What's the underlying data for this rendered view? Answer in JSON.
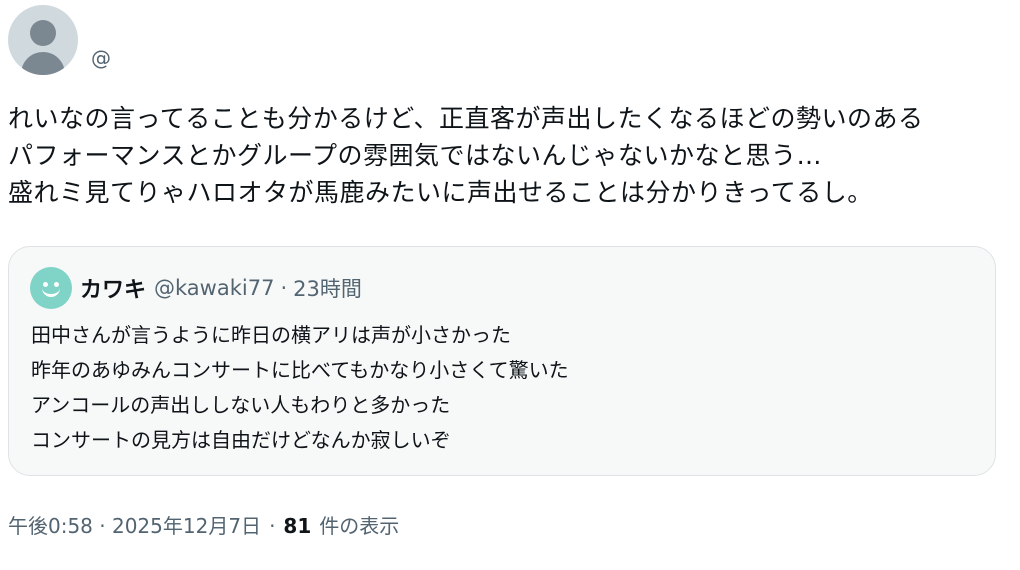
{
  "post": {
    "author_handle": "@",
    "text_lines": [
      "れいなの言ってることも分かるけど、正直客が声出したくなるほどの勢いのある",
      "パフォーマンスとかグループの雰囲気ではないんじゃないかなと思う…",
      "盛れミ見てりゃハロオタが馬鹿みたいに声出せることは分かりきってるし。"
    ],
    "timestamp": "午後0:58 · 2025年12月7日",
    "separator": "·",
    "view_count": "81",
    "view_label": "件の表示"
  },
  "quote": {
    "author_name": "カワキ",
    "author_handle": "@kawaki77",
    "separator": "·",
    "time": "23時間",
    "text_lines": [
      "田中さんが言うように昨日の横アリは声が小さかった",
      "昨年のあゆみんコンサートに比べてもかなり小さくて驚いた",
      "アンコールの声出ししない人もわりと多かった",
      "コンサートの見方は自由だけどなんか寂しいぞ"
    ]
  },
  "colors": {
    "text_primary": "#0f1419",
    "text_secondary": "#536471",
    "quote_background": "#f7f9f9",
    "quote_avatar": "#7fd3c7",
    "default_avatar": "#cfd9de"
  }
}
